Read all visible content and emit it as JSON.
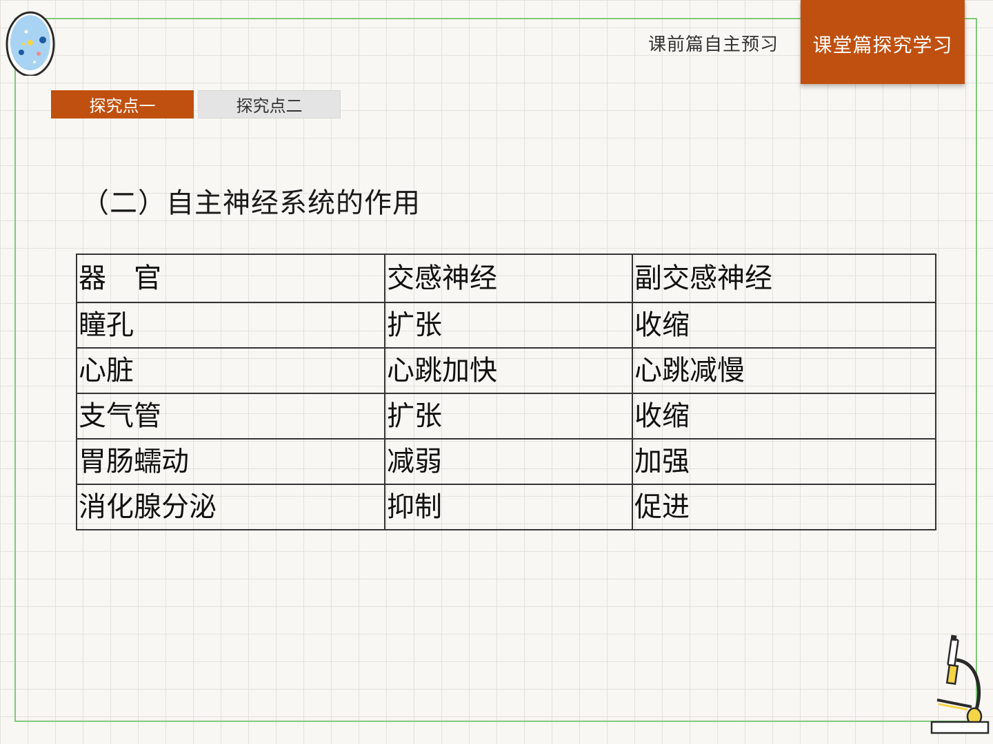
{
  "nav": {
    "prev_label": "课前篇自主预习",
    "active_label": "课堂篇探究学习"
  },
  "tabs": [
    {
      "label": "探究点一",
      "active": true
    },
    {
      "label": "探究点二",
      "active": false
    }
  ],
  "heading": "（二）自主神经系统的作用",
  "table": {
    "headers": [
      "器　官",
      "交感神经",
      "副交感神经"
    ],
    "rows": [
      [
        "瞳孔",
        "扩张",
        "收缩"
      ],
      [
        "心脏",
        "心跳加快",
        "心跳减慢"
      ],
      [
        "支气管",
        "扩张",
        "收缩"
      ],
      [
        "胃肠蠕动",
        "减弱",
        "加强"
      ],
      [
        "消化腺分泌",
        "抑制",
        "促进"
      ]
    ]
  },
  "colors": {
    "accent": "#c0500f",
    "frame": "#7fc97a",
    "tab_inactive": "#e4e4e4"
  },
  "icons": [
    "petri-dish-icon",
    "microscope-icon"
  ]
}
